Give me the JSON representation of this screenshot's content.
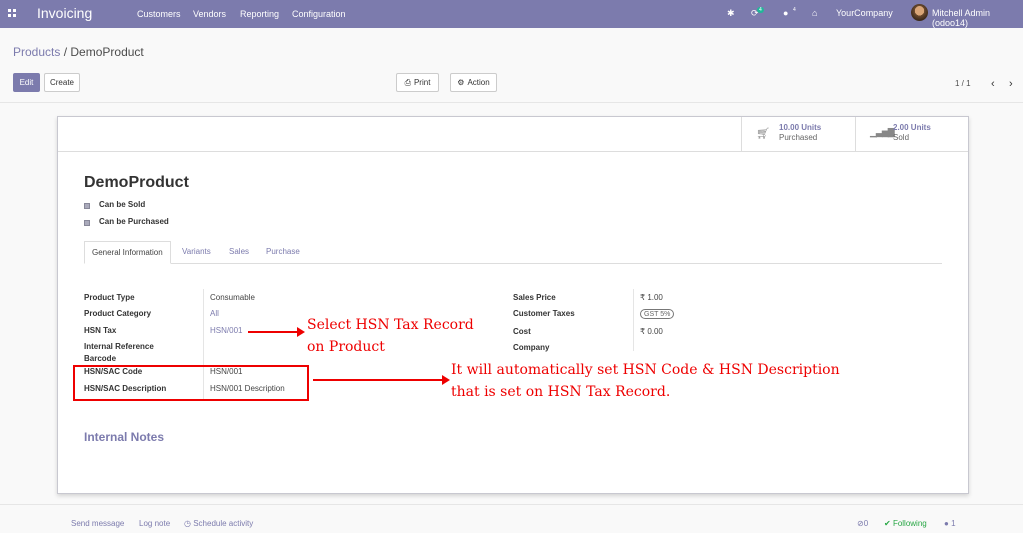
{
  "navbar": {
    "app_name": "Invoicing",
    "menus": [
      "Customers",
      "Vendors",
      "Reporting",
      "Configuration"
    ],
    "activity_count": "4",
    "message_count": "4",
    "company": "YourCompany",
    "user": "Mitchell Admin (odoo14)"
  },
  "breadcrumb": {
    "parent": "Products",
    "separator": "/",
    "current": "DemoProduct"
  },
  "toolbar": {
    "edit": "Edit",
    "create": "Create",
    "print": "Print",
    "action": "Action"
  },
  "pager": {
    "value": "1 / 1"
  },
  "stats": [
    {
      "value": "10.00 Units",
      "label": "Purchased",
      "icon": "shopping-cart-icon"
    },
    {
      "value": "2.00 Units",
      "label": "Sold",
      "icon": "bar-chart-icon"
    }
  ],
  "product": {
    "name": "DemoProduct",
    "can_be_sold": "Can be Sold",
    "can_be_purchased": "Can be Purchased"
  },
  "tabs": [
    "General Information",
    "Variants",
    "Sales",
    "Purchase"
  ],
  "fields_left": [
    {
      "label": "Product Type",
      "value": "Consumable"
    },
    {
      "label": "Product Category",
      "value": "All"
    },
    {
      "label": "HSN Tax",
      "value": "HSN/001"
    },
    {
      "label": "Internal Reference",
      "value": ""
    },
    {
      "label": "Barcode",
      "value": ""
    },
    {
      "label": "HSN/SAC Code",
      "value": "HSN/001"
    },
    {
      "label": "HSN/SAC Description",
      "value": "HSN/001 Description"
    }
  ],
  "fields_right": [
    {
      "label": "Sales Price",
      "value": "₹ 1.00"
    },
    {
      "label": "Customer Taxes",
      "value": "GST 5%"
    },
    {
      "label": "Cost",
      "value": "₹ 0.00"
    },
    {
      "label": "Company",
      "value": ""
    }
  ],
  "internal_notes": "Internal Notes",
  "annotations": {
    "note1_line1": "Select HSN Tax Record",
    "note1_line2": "on Product",
    "note2_line1": "It will automatically set HSN Code & HSN Description",
    "note2_line2": "that is set on HSN Tax Record."
  },
  "chatter": {
    "send_message": "Send message",
    "log_note": "Log note",
    "schedule_activity": "Schedule activity",
    "attachments": "0",
    "following": "Following",
    "followers": "1"
  },
  "colors": {
    "brand": "#7c7bad",
    "annotation": "#e00000",
    "badge": "#21b799"
  }
}
